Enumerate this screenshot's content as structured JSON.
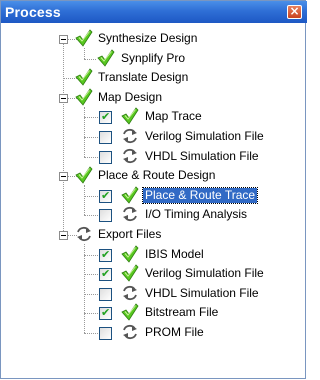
{
  "panel": {
    "title": "Process",
    "close_glyph": "×"
  },
  "tree": [
    {
      "label": "Synthesize Design",
      "icon": "check-icon",
      "children": [
        {
          "label": "Synplify Pro",
          "icon": "check-icon"
        }
      ]
    },
    {
      "label": "Translate Design",
      "icon": "check-icon"
    },
    {
      "label": "Map Design",
      "icon": "check-icon",
      "children": [
        {
          "label": "Map Trace",
          "icon": "check-icon",
          "checked": true
        },
        {
          "label": "Verilog Simulation File",
          "icon": "refresh-icon",
          "checked": false
        },
        {
          "label": "VHDL Simulation File",
          "icon": "refresh-icon",
          "checked": false
        }
      ]
    },
    {
      "label": "Place & Route Design",
      "icon": "check-icon",
      "children": [
        {
          "label": "Place & Route Trace",
          "icon": "check-icon",
          "checked": true,
          "selected": true
        },
        {
          "label": "I/O Timing Analysis",
          "icon": "refresh-icon",
          "checked": false
        }
      ]
    },
    {
      "label": "Export Files",
      "icon": "refresh-icon",
      "children": [
        {
          "label": "IBIS Model",
          "icon": "check-icon",
          "checked": true
        },
        {
          "label": "Verilog Simulation File",
          "icon": "check-icon",
          "checked": true
        },
        {
          "label": "VHDL Simulation File",
          "icon": "refresh-icon",
          "checked": false
        },
        {
          "label": "Bitstream File",
          "icon": "check-icon",
          "checked": true
        },
        {
          "label": "PROM File",
          "icon": "refresh-icon",
          "checked": false
        }
      ]
    }
  ]
}
